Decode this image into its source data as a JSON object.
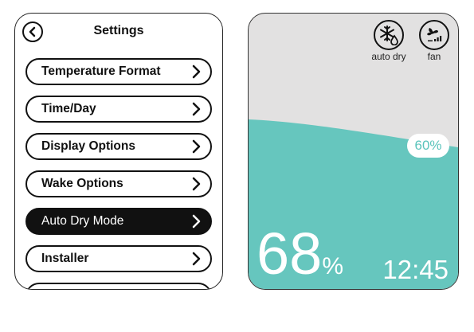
{
  "settings": {
    "title": "Settings",
    "items": [
      {
        "label": "Temperature Format"
      },
      {
        "label": "Time/Day"
      },
      {
        "label": "Display Options"
      },
      {
        "label": "Wake Options"
      },
      {
        "label": "Auto Dry Mode",
        "active": true
      },
      {
        "label": "Installer"
      }
    ]
  },
  "display": {
    "modes": [
      {
        "label": "auto dry",
        "icon": "snowflake-drop-icon"
      },
      {
        "label": "fan",
        "icon": "fan-icon"
      }
    ],
    "target_humidity": "60%",
    "current_humidity": "68",
    "humidity_unit": "%",
    "time": "12:45",
    "colors": {
      "fill": "#66c6be",
      "background": "#e2e1e1",
      "accent": "#111111"
    }
  }
}
